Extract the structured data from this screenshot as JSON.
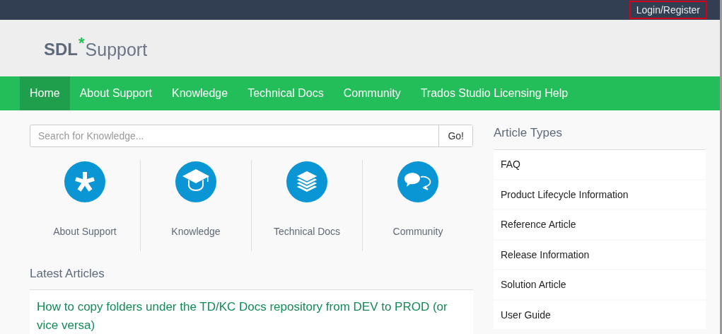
{
  "top_bar": {
    "login_link": "Login/Register",
    "highlighted": true
  },
  "logo": {
    "brand": "SDL",
    "mark": "*",
    "product": "Support"
  },
  "nav": [
    {
      "label": "Home",
      "selected": true
    },
    {
      "label": "About Support",
      "selected": false
    },
    {
      "label": "Knowledge",
      "selected": false
    },
    {
      "label": "Technical Docs",
      "selected": false
    },
    {
      "label": "Community",
      "selected": false
    },
    {
      "label": "Trados Studio Licensing Help",
      "selected": false
    }
  ],
  "search": {
    "placeholder": "Search for Knowledge...",
    "button": "Go!"
  },
  "tiles": [
    {
      "label": "About Support",
      "kind": "asterisk"
    },
    {
      "label": "Knowledge",
      "kind": "graduation"
    },
    {
      "label": "Technical Docs",
      "kind": "stack"
    },
    {
      "label": "Community",
      "kind": "chat"
    }
  ],
  "latest_articles": {
    "heading": "Latest Articles",
    "items": [
      "How to copy folders under the TD/KC Docs repository from DEV to PROD (or vice versa)"
    ]
  },
  "article_types": {
    "heading": "Article Types",
    "items": [
      "FAQ",
      "Product Lifecycle Information",
      "Reference Article",
      "Release Information",
      "Solution Article",
      "User Guide"
    ]
  }
}
